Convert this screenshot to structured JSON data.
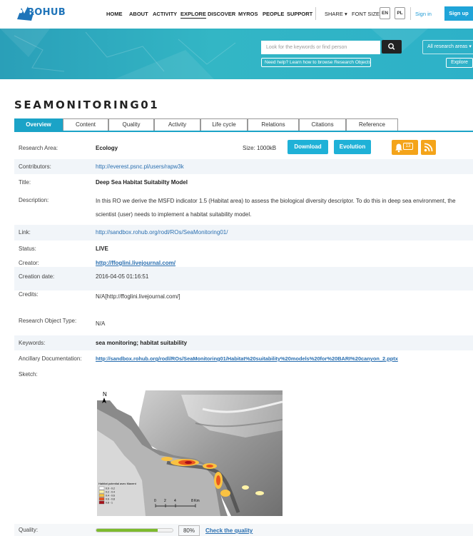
{
  "brand": {
    "logo_text": "ROHUB"
  },
  "nav": {
    "items": [
      "HOME",
      "ABOUT",
      "ACTIVITY",
      "EXPLORE",
      "DISCOVER",
      "MYROS",
      "PEOPLE",
      "SUPPORT"
    ],
    "active": "EXPLORE",
    "share": "SHARE",
    "font_size": "FONT SIZE",
    "lang_en": "EN",
    "lang_pl": "PL",
    "sign_in": "Sign in",
    "sign_up": "Sign up"
  },
  "banner": {
    "search_placeholder": "Look for the keywords or find person",
    "areas_select": "All research areas",
    "help_link": "Need help? Learn how to browse Research Objects ...",
    "explore": "Explore"
  },
  "page_title": "SEAMONITORING01",
  "tabs": [
    "Overview",
    "Content",
    "Quality",
    "Activity",
    "Life cycle",
    "Relations",
    "Citations",
    "Reference"
  ],
  "active_tab": "Overview",
  "details": {
    "research_area_label": "Research Area:",
    "research_area": "Ecology",
    "size": "Size: 1000kB",
    "download": "Download",
    "evolution": "Evolution",
    "notifications_count": "13",
    "contributors_label": "Contributors:",
    "contributors": "http://everest.psnc.pl/users/rapw3k",
    "title_label": "Title:",
    "title": "Deep Sea Habitat Suitabilty Model",
    "description_label": "Description:",
    "description": "In this RO we derive the MSFD indicator 1.5 (Habitat area) to assess the biological diversity descriptor. To do this in deep sea environment, the scientist (user) needs to implement a habitat suitability model.",
    "link_label": "Link:",
    "link": "http://sandbox.rohub.org/rodl/ROs/SeaMonitoring01/",
    "status_label": "Status:",
    "status": "LIVE",
    "creator_label": "Creator:",
    "creator": "http://ffoglini.livejournal.com/",
    "creation_date_label": "Creation date:",
    "creation_date": "2016-04-05 01:16:51",
    "credits_label": "Credits:",
    "credits": "N/A[http://ffoglini.livejournal.com/]",
    "ro_type_label": "Research Object Type:",
    "ro_type": "N/A",
    "keywords_label": "Keywords:",
    "keywords": "sea monitoring; habitat suitability",
    "ancillary_label": "Ancillary Documentation:",
    "ancillary": "http://sandbox.rohub.org/rodl/ROs/SeaMonitoring01/Habitat%20suitability%20models%20for%20BARI%20canyon_2.pptx",
    "sketch_label": "Sketch:",
    "quality_label": "Quality:",
    "quality_percent": "80%",
    "quality_value": 0.8,
    "quality_link": "Check the quality"
  },
  "sketch": {
    "north": "N",
    "legend_title": "Habitat potential avec Maxent",
    "legend_items": [
      "0.0 - 0.2",
      "0.2 - 0.4",
      "0.4 - 0.6",
      "0.6 - 0.8",
      "0.8 - 1"
    ],
    "legend_colors": [
      "#ffffff",
      "#fff3a8",
      "#f9c242",
      "#e8541f",
      "#a8101a"
    ],
    "scale_labels": [
      "0",
      "2",
      "4",
      "8 Km"
    ]
  },
  "colors": {
    "accent": "#1ba3c7",
    "orange": "#f4a41a",
    "link": "#2a6fb0",
    "quality": "#7dbb2e"
  }
}
